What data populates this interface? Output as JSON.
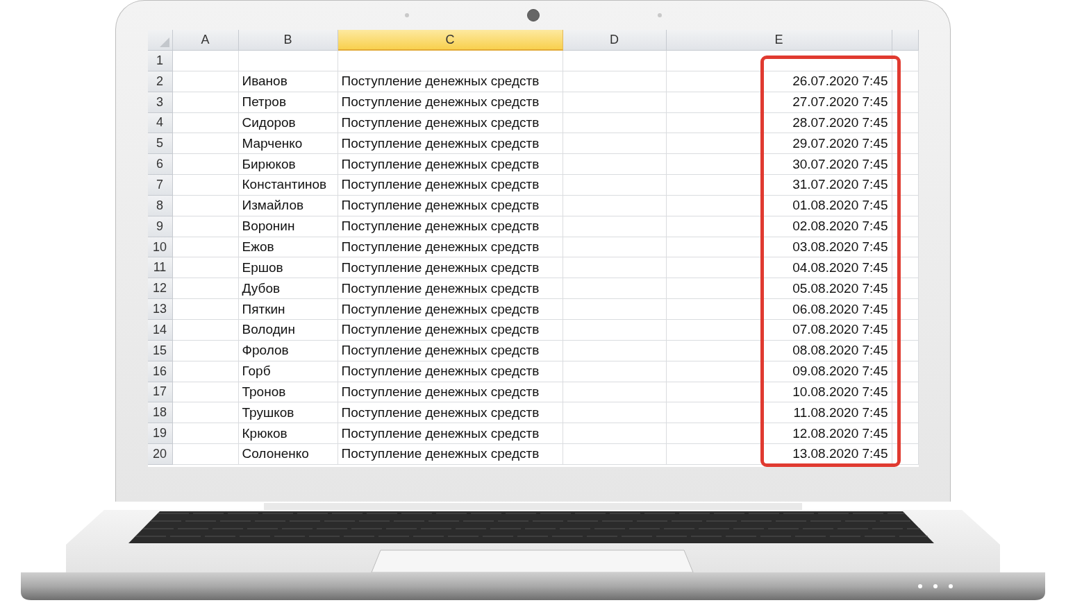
{
  "columns": [
    {
      "label": "A",
      "selected": false,
      "highlighted": false
    },
    {
      "label": "B",
      "selected": false,
      "highlighted": false
    },
    {
      "label": "C",
      "selected": true,
      "highlighted": false
    },
    {
      "label": "D",
      "selected": false,
      "highlighted": false
    },
    {
      "label": "E",
      "selected": false,
      "highlighted": true
    }
  ],
  "rows": [
    {
      "number": "1"
    },
    {
      "number": "2",
      "b": "Иванов",
      "c": "Поступление денежных средств",
      "e": "26.07.2020 7:45"
    },
    {
      "number": "3",
      "b": "Петров",
      "c": "Поступление денежных средств",
      "e": "27.07.2020 7:45"
    },
    {
      "number": "4",
      "b": "Сидоров",
      "c": "Поступление денежных средств",
      "e": "28.07.2020 7:45"
    },
    {
      "number": "5",
      "b": "Марченко",
      "c": "Поступление денежных средств",
      "e": "29.07.2020 7:45"
    },
    {
      "number": "6",
      "b": "Бирюков",
      "c": "Поступление денежных средств",
      "e": "30.07.2020 7:45"
    },
    {
      "number": "7",
      "b": "Константинов",
      "c": "Поступление денежных средств",
      "e": "31.07.2020 7:45"
    },
    {
      "number": "8",
      "b": "Измайлов",
      "c": "Поступление денежных средств",
      "e": "01.08.2020 7:45"
    },
    {
      "number": "9",
      "b": "Воронин",
      "c": "Поступление денежных средств",
      "e": "02.08.2020 7:45"
    },
    {
      "number": "10",
      "b": "Ежов",
      "c": "Поступление денежных средств",
      "e": "03.08.2020 7:45"
    },
    {
      "number": "11",
      "b": "Ершов",
      "c": "Поступление денежных средств",
      "e": "04.08.2020 7:45"
    },
    {
      "number": "12",
      "b": "Дубов",
      "c": "Поступление денежных средств",
      "e": "05.08.2020 7:45"
    },
    {
      "number": "13",
      "b": "Пяткин",
      "c": "Поступление денежных средств",
      "e": "06.08.2020 7:45"
    },
    {
      "number": "14",
      "b": "Володин",
      "c": "Поступление денежных средств",
      "e": "07.08.2020 7:45"
    },
    {
      "number": "15",
      "b": "Фролов",
      "c": "Поступление денежных средств",
      "e": "08.08.2020 7:45"
    },
    {
      "number": "16",
      "b": "Горб",
      "c": "Поступление денежных средств",
      "e": "09.08.2020 7:45"
    },
    {
      "number": "17",
      "b": "Тронов",
      "c": "Поступление денежных средств",
      "e": "10.08.2020 7:45"
    },
    {
      "number": "18",
      "b": "Трушков",
      "c": "Поступление денежных средств",
      "e": "11.08.2020 7:45"
    },
    {
      "number": "19",
      "b": "Крюков",
      "c": "Поступление денежных средств",
      "e": "12.08.2020 7:45"
    },
    {
      "number": "20",
      "b": "Солоненко",
      "c": "Поступление денежных средств",
      "e": "13.08.2020 7:45"
    }
  ]
}
